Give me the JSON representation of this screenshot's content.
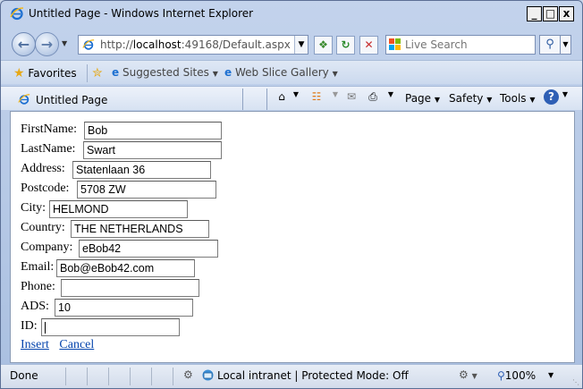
{
  "window": {
    "title": "Untitled Page - Windows Internet Explorer",
    "min_glyph": "_",
    "max_glyph": "□",
    "close_glyph": "x"
  },
  "address": {
    "url_prefix": "http://",
    "url_host": "localhost",
    "url_rest": ":49168/Default.aspx"
  },
  "search": {
    "placeholder": "Live Search"
  },
  "favorites": {
    "favorites_label": "Favorites",
    "suggested_label": "Suggested Sites",
    "webslice_label": "Web Slice Gallery"
  },
  "tab": {
    "label": "Untitled Page"
  },
  "commands": {
    "page_label": "Page",
    "safety_label": "Safety",
    "tools_label": "Tools"
  },
  "form": {
    "fields": [
      {
        "label": "FirstName:",
        "value": "Bob"
      },
      {
        "label": "LastName:",
        "value": "Swart"
      },
      {
        "label": "Address:",
        "value": "Statenlaan 36"
      },
      {
        "label": "Postcode:",
        "value": "5708 ZW"
      },
      {
        "label": "City:",
        "value": "HELMOND"
      },
      {
        "label": "Country:",
        "value": "THE NETHERLANDS"
      },
      {
        "label": "Company:",
        "value": "eBob42"
      },
      {
        "label": "Email:",
        "value": "Bob@eBob42.com"
      },
      {
        "label": "Phone:",
        "value": ""
      },
      {
        "label": "ADS:",
        "value": "10"
      },
      {
        "label": "ID:",
        "value": ""
      }
    ],
    "insert_label": "Insert",
    "cancel_label": "Cancel"
  },
  "status": {
    "text": "Done",
    "zone": "Local intranet | Protected Mode: Off",
    "zoom": "100%"
  },
  "colors": {
    "link": "#0645ad",
    "chrome": "#c3d3ec"
  }
}
